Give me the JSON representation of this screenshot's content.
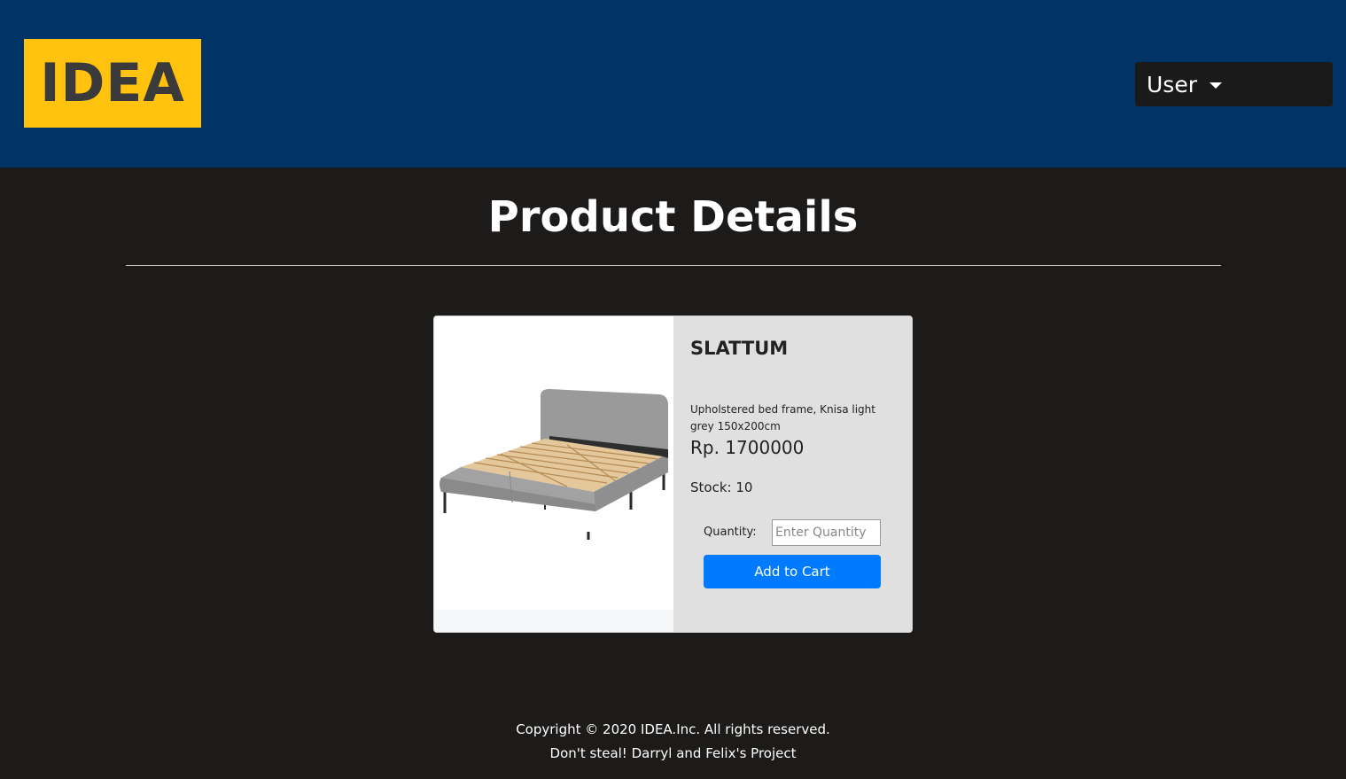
{
  "header": {
    "logo_text": "IDEA",
    "user_menu_label": "User"
  },
  "page": {
    "title": "Product Details"
  },
  "product": {
    "name": "SLATTUM",
    "description": "Upholstered bed frame, Knisa light grey 150x200cm",
    "price": "Rp. 1700000",
    "stock": "Stock: 10",
    "quantity_label": "Quantity:",
    "quantity_placeholder": "Enter Quantity",
    "add_to_cart_label": "Add to Cart",
    "image_icon": "bed-frame-image"
  },
  "footer": {
    "copyright": "Copyright © 2020 IDEA.Inc. All rights reserved.",
    "tagline": "Don't steal! Darryl and Felix's Project"
  },
  "colors": {
    "header_bg": "#003366",
    "logo_bg": "#ffc20e",
    "page_bg": "#1c1b1a",
    "button": "#007bff"
  }
}
